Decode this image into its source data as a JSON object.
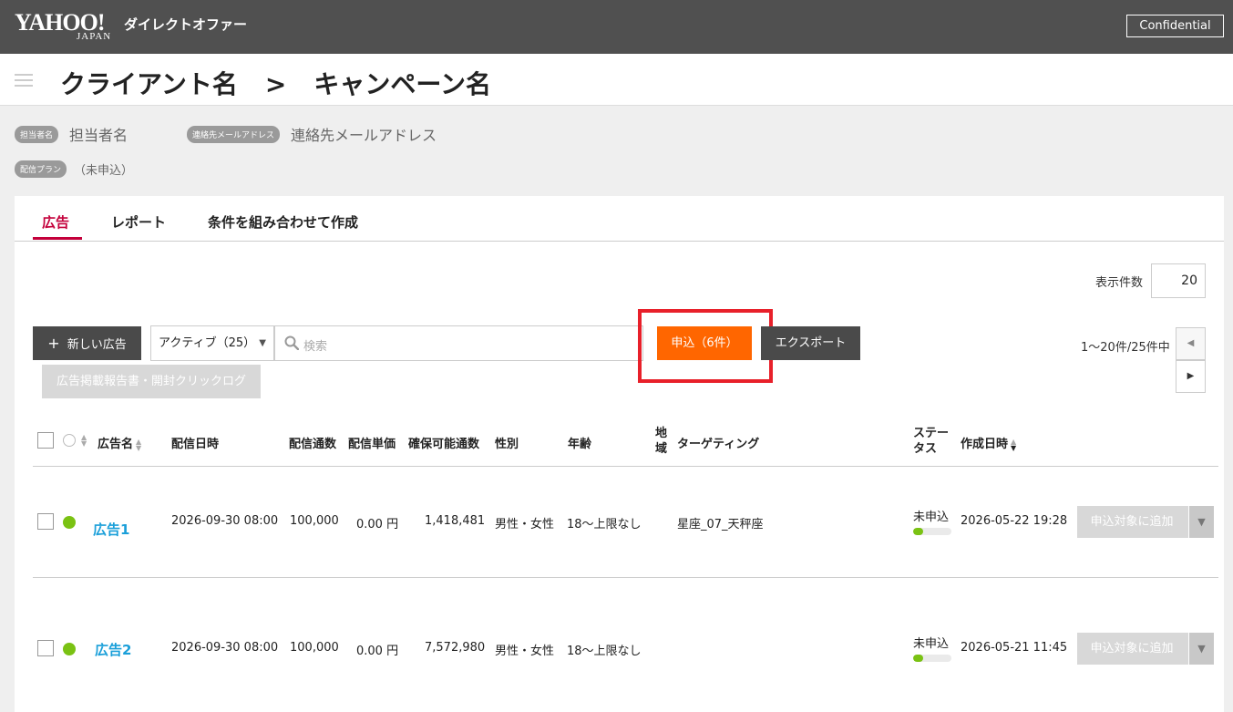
{
  "app": {
    "logo_main": "YAHOO!",
    "logo_sub": "JAPAN",
    "product_name": "ダイレクトオファー",
    "badge": "Confidential"
  },
  "header": {
    "client": "クライアント名",
    "separator": ">",
    "campaign": "キャンペーン名"
  },
  "info": {
    "owner_label": "担当者名",
    "owner_value": "担当者名",
    "email_label": "連絡先メールアドレス",
    "email_value": "連絡先メールアドレス",
    "plan_label": "配信プラン",
    "plan_value": "（未申込）"
  },
  "tabs": [
    {
      "label": "広告",
      "active": true
    },
    {
      "label": "レポート",
      "active": false
    },
    {
      "label": "条件を組み合わせて作成",
      "active": false
    }
  ],
  "toolbar": {
    "per_page_label": "表示件数",
    "per_page_value": "20",
    "new_ad_label": "新しい広告",
    "filter_value": "アクティブ（25）",
    "search_placeholder": "検索",
    "apply_label": "申込（6件）",
    "export_label": "エクスポート",
    "log_label": "広告掲載報告書・開封クリックログ",
    "range_text": "1〜20件/25件中"
  },
  "table": {
    "headers": {
      "name": "広告名",
      "date": "配信日時",
      "count": "配信通数",
      "unit_price": "配信単価",
      "available": "確保可能通数",
      "gender": "性別",
      "age": "年齢",
      "region_1": "地",
      "region_2": "域",
      "targeting": "ターゲティング",
      "status_1": "ステー",
      "status_2": "タス",
      "created": "作成日時"
    },
    "rows": [
      {
        "name": "広告1",
        "date": "2026-09-30 08:00",
        "count": "100,000",
        "unit_price": "0.00 円",
        "available": "1,418,481",
        "gender": "男性・女性",
        "age": "18〜上限なし",
        "targeting": "星座_07_天秤座",
        "status": "未申込",
        "status_progress": 0.25,
        "created": "2026-05-22 19:28",
        "action": "申込対象に追加"
      },
      {
        "name": "広告2",
        "date": "2026-09-30 08:00",
        "count": "100,000",
        "unit_price": "0.00 円",
        "available": "7,572,980",
        "gender": "男性・女性",
        "age": "18〜上限なし",
        "targeting": "",
        "status": "未申込",
        "status_progress": 0.25,
        "created": "2026-05-21 11:45",
        "action": "申込対象に追加"
      }
    ]
  },
  "colors": {
    "topbar": "#505050",
    "active_tab": "#c4003b",
    "apply_button": "#ff6600",
    "highlight_frame": "#e8202a",
    "link": "#1a9fd9",
    "status_dot": "#7ac213"
  }
}
